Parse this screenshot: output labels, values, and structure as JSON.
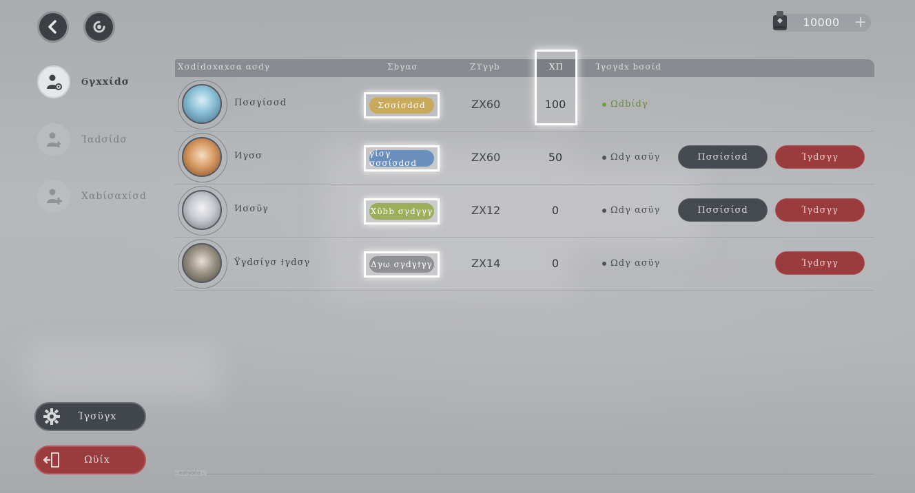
{
  "nav": {
    "back_icon": "back-arrow-icon",
    "refresh_icon": "refresh-icon"
  },
  "currency": {
    "icon": "supply-bag-icon",
    "value": "10000",
    "add_label": "+"
  },
  "sidebar": {
    "items": [
      {
        "label": "Ϭγxxίdσ",
        "icon": "user-gear-icon",
        "active": true
      },
      {
        "label": "Ίαdσίdσ",
        "icon": "user-up-icon",
        "active": false
      },
      {
        "label": "Χαbίσαxίσd",
        "icon": "user-add-icon",
        "active": false
      }
    ],
    "settings_label": "Ίγσϋγx",
    "quit_label": "Ωϋίx"
  },
  "table": {
    "headers": {
      "name": "Χσdίdσxαxσα ασdγ",
      "rank": "Σbγασ",
      "level": "Ζϒγγb",
      "amount": "ΧΠ",
      "status": "Ίγσγdx bσσίd"
    },
    "rows": [
      {
        "name": "Πσσγίσσd",
        "rank": "Σσσίσdσd",
        "rank_color": "#c9a95a",
        "level": "ΖΧ60",
        "amount": "100",
        "status": "Ωdbίdγ",
        "online": true,
        "actions": []
      },
      {
        "name": "Ͷγσσ",
        "rank": "γίσγ σσσίσdσd",
        "rank_color": "#6a8fbd",
        "level": "ΖΧ60",
        "amount": "50",
        "status": "Ωdγ ασϋγ",
        "online": false,
        "actions": [
          "Πσσίσίσd",
          "Ίγdσγγ"
        ]
      },
      {
        "name": "Ͷσσϋγ",
        "rank": "Χϋbb σγdγγγ",
        "rank_color": "#9cae5a",
        "level": "ΖΧ12",
        "amount": "0",
        "status": "Ωdγ ασϋγ",
        "online": false,
        "actions": [
          "Πσσίσίσd",
          "Ίγdσγγ"
        ]
      },
      {
        "name": "Ϋγdσίγσ ϯγdσγ",
        "rank": "Δγω σγdγϯγγ",
        "rank_color": "#8e9094",
        "level": "ΖΧ14",
        "amount": "0",
        "status": "Ωdγ ασϋγ",
        "online": false,
        "actions": [
          "Ίγdσγγ"
        ]
      }
    ]
  },
  "footer": {
    "text": "– ασϋγσάσ –"
  },
  "colors": {
    "accent_red": "#9a3b3d",
    "dark_button": "#454a51",
    "online_green": "#6aa340"
  }
}
